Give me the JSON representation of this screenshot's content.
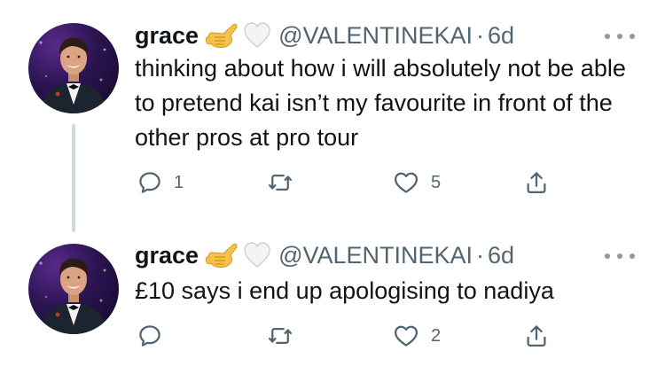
{
  "colors": {
    "text": "#0f1419",
    "secondary": "#536471",
    "thread_line": "#cfd9de",
    "background": "#ffffff"
  },
  "tweets": [
    {
      "author_name": "grace",
      "emoji": [
        "call-me-hand-emoji",
        "white-heart-emoji"
      ],
      "handle": "@VALENTINEKAI",
      "separator": "·",
      "time": "6d",
      "text": "thinking about how i will absolutely not be able to pretend kai isn’t my favourite in front of the other pros at pro tour",
      "replies": "1",
      "retweets": "",
      "likes": "5"
    },
    {
      "author_name": "grace",
      "emoji": [
        "call-me-hand-emoji",
        "white-heart-emoji"
      ],
      "handle": "@VALENTINEKAI",
      "separator": "·",
      "time": "6d",
      "text": "£10 says i end up apologising to nadiya",
      "replies": "",
      "retweets": "",
      "likes": "2"
    }
  ]
}
